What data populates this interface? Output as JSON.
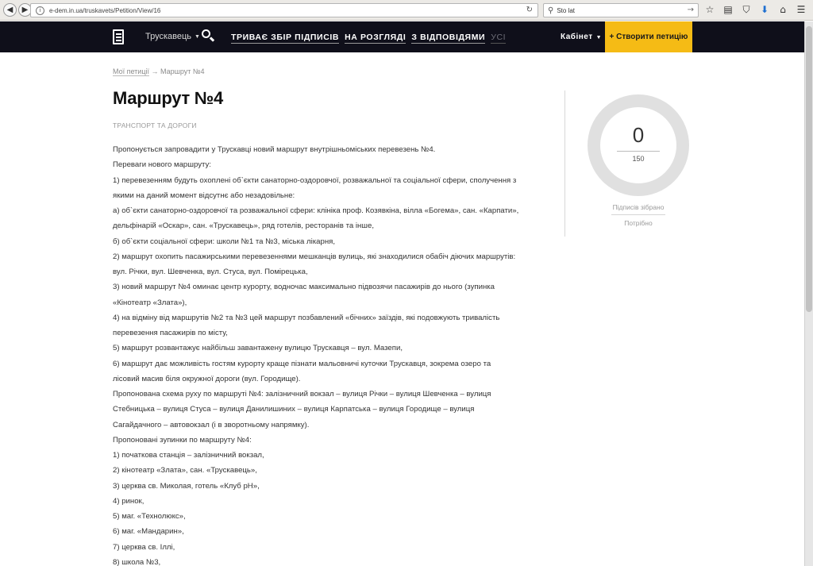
{
  "browser": {
    "url": "e-dem.in.ua/truskavets/Petition/View/16",
    "search_value": "Sto lat"
  },
  "header": {
    "city": "Трускавець",
    "nav": [
      {
        "label": "ТРИВАЄ ЗБІР ПІДПИСІВ"
      },
      {
        "label": "НА РОЗГЛЯДІ"
      },
      {
        "label": "З ВІДПОВІДЯМИ"
      },
      {
        "label": "УСІ"
      }
    ],
    "cabinet": "Кабінет",
    "create_button": "+ Створити петицію"
  },
  "breadcrumb": {
    "link": "Мої петиції",
    "arrow": "→",
    "current": "Маршрут №4"
  },
  "petition": {
    "title": "Маршрут №4",
    "category": "ТРАНСПОРТ ТА ДОРОГИ",
    "lines": [
      "Пропонується запровадити у Трускавці новий маршрут внутрішньоміських перевезень №4.",
      "Переваги нового маршруту:",
      "1) перевезенням будуть охоплені об`єкти санаторно-оздоровчої, розважальної та соціальної сфери, сполучення з",
      "якими на даний момент відсутнє або незадовільне:",
      "а) об`єкти санаторно-оздоровчої та розважальної сфери: клініка проф. Козявкіна, вілла «Богема», сан. «Карпати»,",
      "дельфінарій «Оскар», сан. «Трускавець», ряд готелів, ресторанів та інше,",
      "б) об`єкти соціальної сфери: школи №1 та №3, міська лікарня,",
      "2) маршрут охопить пасажирськими перевезеннями мешканців вулиць, які знаходилися обабіч діючих маршрутів:",
      "вул. Річки, вул. Шевченка, вул. Стуса, вул. Помірецька,",
      "3) новий маршрут №4 оминає центр курорту, водночас максимально підвозячи пасажирів до нього (зупинка",
      "«Кінотеатр «Злата»),",
      "4) на відміну від маршрутів №2 та №3 цей маршрут позбавлений «бічних» заїздів, які подовжують тривалість",
      "перевезення пасажирів по місту,",
      "5) маршрут розвантажує найбільш завантажену вулицю Трускавця – вул. Мазепи,",
      "6) маршрут дає можливість гостям курорту краще пізнати мальовничі куточки Трускавця, зокрема озеро та",
      "лісовий масив біля окружної дороги (вул. Городище).",
      "Пропонована схема руху по маршруті №4: залізничний вокзал – вулиця Річки – вулиця Шевченка – вулиця",
      "Стебницька – вулиця Стуса – вулиця Данилишиних – вулиця Карпатська – вулиця Городище – вулиця",
      "Сагайдачного – автовокзал (і в зворотньому напрямку).",
      "Пропоновані зупинки по маршруту №4:",
      "1) початкова станція – залізничний вокзал,",
      "2) кінотеатр «Злата», сан. «Трускавець»,",
      "3) церква св. Миколая, готель «Клуб рН»,",
      "4) ринок,",
      "5) маг. «Технолюкс»,",
      "6) маг. «Мандарин»,",
      "7) церква св. Іллі,",
      "8) школа №3,"
    ]
  },
  "signatures": {
    "count": "0",
    "goal": "150",
    "collected_label": "Підписів зібрано",
    "needed_label": "Потрібно",
    "progress": 0
  },
  "colors": {
    "header_bg": "#0f0f1a",
    "accent": "#f5bb15",
    "ring": "#e0e0e0"
  }
}
